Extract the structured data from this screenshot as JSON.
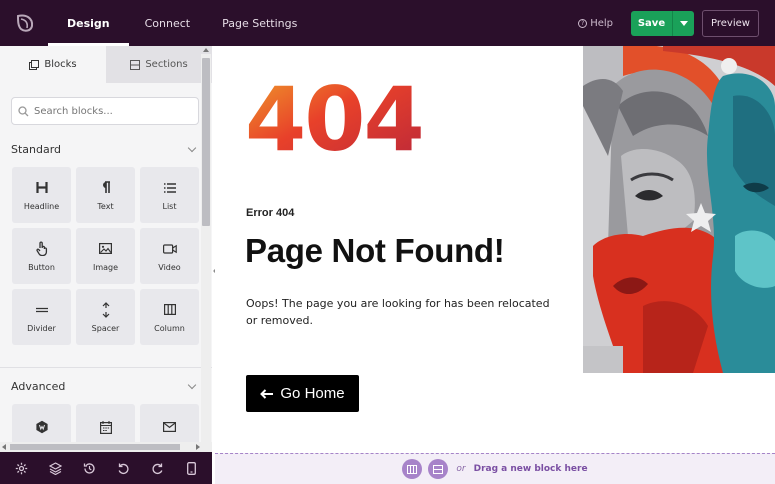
{
  "topbar": {
    "tabs": [
      {
        "label": "Design",
        "active": true
      },
      {
        "label": "Connect",
        "active": false
      },
      {
        "label": "Page Settings",
        "active": false
      }
    ],
    "help_label": "Help",
    "save_label": "Save",
    "preview_label": "Preview"
  },
  "sidebar": {
    "tabs": [
      {
        "label": "Blocks",
        "active": true
      },
      {
        "label": "Sections",
        "active": false
      }
    ],
    "search": {
      "placeholder": "Search blocks...",
      "value": ""
    },
    "standard": {
      "title": "Standard",
      "blocks": [
        {
          "label": "Headline",
          "icon": "heading-icon"
        },
        {
          "label": "Text",
          "icon": "paragraph-icon"
        },
        {
          "label": "List",
          "icon": "list-icon"
        },
        {
          "label": "Button",
          "icon": "pointer-icon"
        },
        {
          "label": "Image",
          "icon": "image-icon"
        },
        {
          "label": "Video",
          "icon": "video-icon"
        },
        {
          "label": "Divider",
          "icon": "divider-icon"
        },
        {
          "label": "Spacer",
          "icon": "spacer-icon"
        },
        {
          "label": "Column",
          "icon": "column-icon"
        }
      ]
    },
    "advanced": {
      "title": "Advanced",
      "blocks": [
        {
          "icon": "wpforms-icon"
        },
        {
          "icon": "calendar-icon"
        },
        {
          "icon": "envelope-icon"
        }
      ]
    }
  },
  "bottombar": {
    "icons": [
      "gear-icon",
      "layers-icon",
      "history-icon",
      "undo-icon",
      "redo-icon",
      "mobile-icon"
    ]
  },
  "canvas": {
    "big_number": "404",
    "error_label": "Error 404",
    "title": "Page Not Found!",
    "description": "Oops! The page you are looking for has been relocated or removed.",
    "button_label": "Go Home"
  },
  "dropzone": {
    "or_text": "or",
    "action_text": "Drag a new block here"
  },
  "colors": {
    "topbar_bg": "#2b0f2b",
    "save_green": "#1aa159",
    "accent_purple": "#a783c9",
    "button_black": "#000000"
  }
}
